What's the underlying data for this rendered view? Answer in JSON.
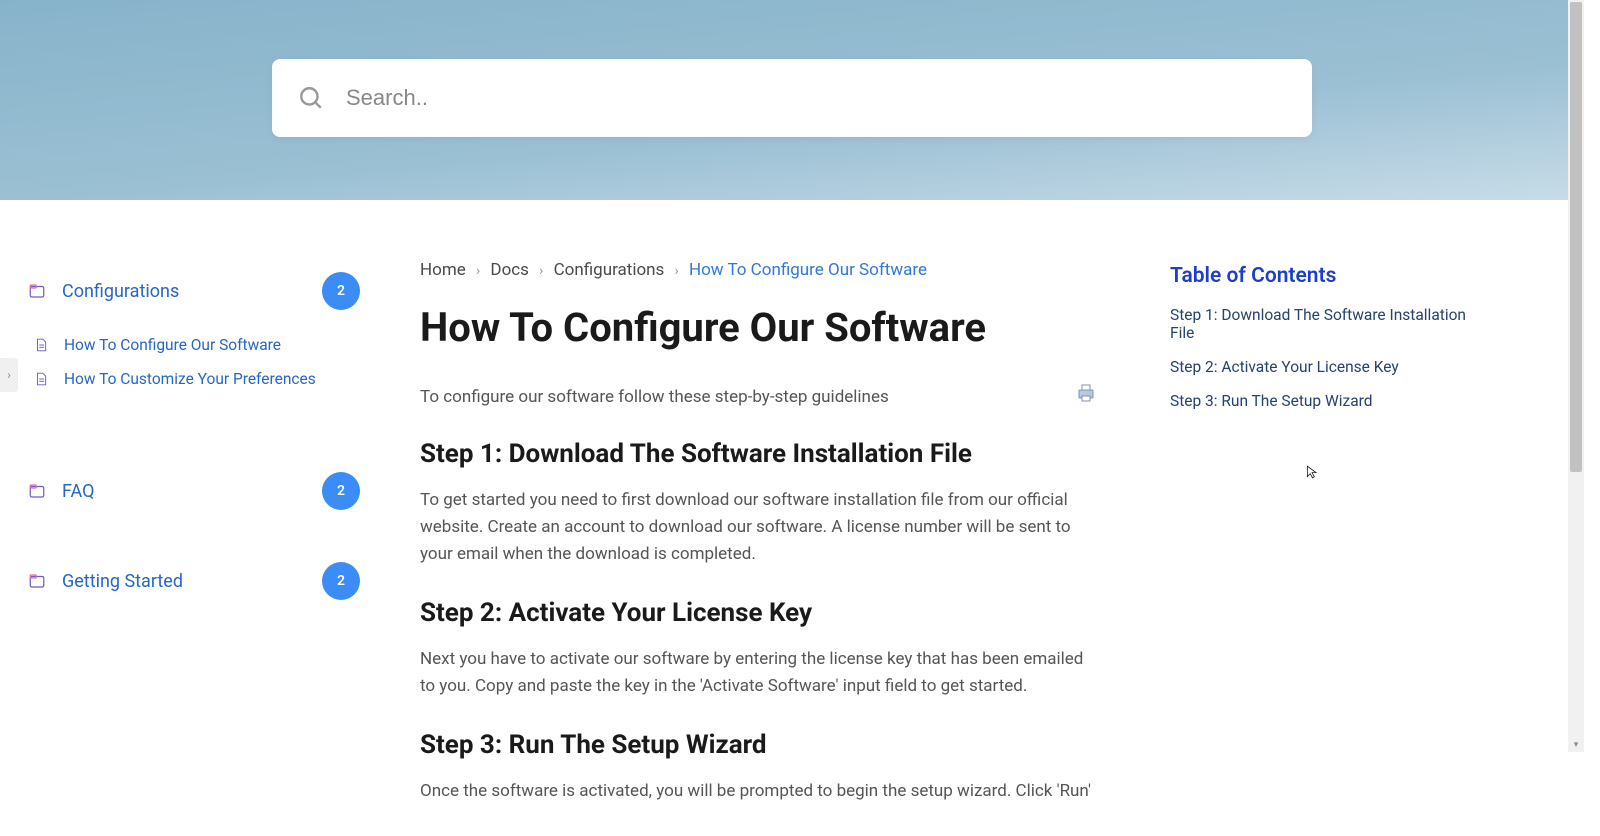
{
  "search": {
    "placeholder": "Search.."
  },
  "sidebar": {
    "categories": [
      {
        "label": "Configurations",
        "count": "2",
        "children": [
          {
            "label": "How To Configure Our Software"
          },
          {
            "label": "How To Customize Your Preferences"
          }
        ]
      },
      {
        "label": "FAQ",
        "count": "2"
      },
      {
        "label": "Getting Started",
        "count": "2"
      }
    ]
  },
  "breadcrumb": {
    "items": [
      "Home",
      "Docs",
      "Configurations",
      "How To Configure Our Software"
    ]
  },
  "article": {
    "title": "How To Configure Our Software",
    "intro": "To configure our software follow these step-by-step guidelines",
    "steps": [
      {
        "heading": "Step 1: Download The Software Installation File",
        "body": "To get started you need to first download our software installation file from our official website. Create an account to download our software. A license number will be sent to your email when the download is completed."
      },
      {
        "heading": "Step 2: Activate Your License Key",
        "body": "Next you have to activate our software by entering the license key that has been emailed to you. Copy and paste the key in the 'Activate Software' input field to get started."
      },
      {
        "heading": "Step 3: Run The Setup Wizard",
        "body": "Once the software is activated, you will be prompted to begin the setup wizard. Click 'Run'"
      }
    ]
  },
  "toc": {
    "title": "Table of Contents",
    "links": [
      "Step 1: Download The Software Installation File",
      "Step 2: Activate Your License Key",
      "Step 3: Run The Setup Wizard"
    ]
  }
}
